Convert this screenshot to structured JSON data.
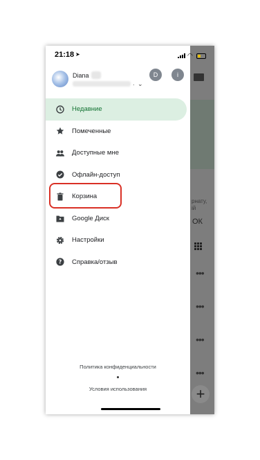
{
  "status_bar": {
    "time": "21:18"
  },
  "account": {
    "name": "Diana",
    "initial_d": "D",
    "info": "i"
  },
  "menu": {
    "items": [
      {
        "label": "Недавние",
        "icon": "clock-icon",
        "active": true
      },
      {
        "label": "Помеченные",
        "icon": "star-icon",
        "active": false
      },
      {
        "label": "Доступные мне",
        "icon": "people-icon",
        "active": false
      },
      {
        "label": "Офлайн-доступ",
        "icon": "offline-check-icon",
        "active": false
      },
      {
        "label": "Корзина",
        "icon": "trash-icon",
        "active": false
      },
      {
        "label": "Google Диск",
        "icon": "drive-folder-icon",
        "active": false
      },
      {
        "label": "Настройки",
        "icon": "gear-icon",
        "active": false
      },
      {
        "label": "Справка/отзыв",
        "icon": "help-icon",
        "active": false
      }
    ]
  },
  "footer": {
    "privacy": "Политика конфиденциальности",
    "terms": "Условия использования"
  },
  "background_app": {
    "text_1": "рнату,",
    "text_2": "ій",
    "ok": "ОК",
    "fab": "+"
  },
  "colors": {
    "active_bg": "#dcefe2",
    "active_text": "#137333",
    "highlight": "#d93025",
    "overlay": "#7d7d7d"
  }
}
